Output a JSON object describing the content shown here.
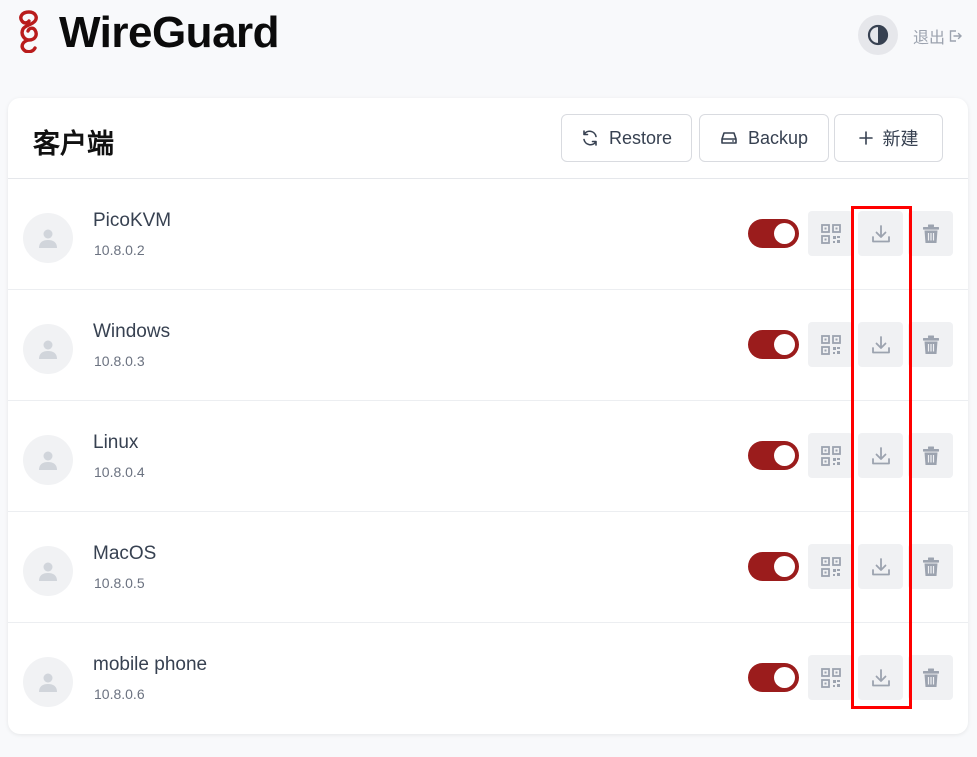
{
  "app": {
    "title": "WireGuard"
  },
  "header": {
    "logout_label": "退出"
  },
  "card": {
    "title": "客户端",
    "buttons": {
      "restore": "Restore",
      "backup": "Backup",
      "new": "新建"
    }
  },
  "clients": [
    {
      "name": "PicoKVM",
      "ip": "10.8.0.2",
      "enabled": true
    },
    {
      "name": "Windows",
      "ip": "10.8.0.3",
      "enabled": true
    },
    {
      "name": "Linux",
      "ip": "10.8.0.4",
      "enabled": true
    },
    {
      "name": "MacOS",
      "ip": "10.8.0.5",
      "enabled": true
    },
    {
      "name": "mobile phone",
      "ip": "10.8.0.6",
      "enabled": true
    }
  ],
  "colors": {
    "accent": "#9b1c1c",
    "highlight": "#ff0000",
    "icon": "#9ca3af"
  },
  "icons": [
    "wireguard-logo",
    "theme-contrast-icon",
    "logout-icon",
    "refresh-icon",
    "server-icon",
    "plus-icon",
    "user-icon",
    "qr-code-icon",
    "download-icon",
    "trash-icon"
  ]
}
